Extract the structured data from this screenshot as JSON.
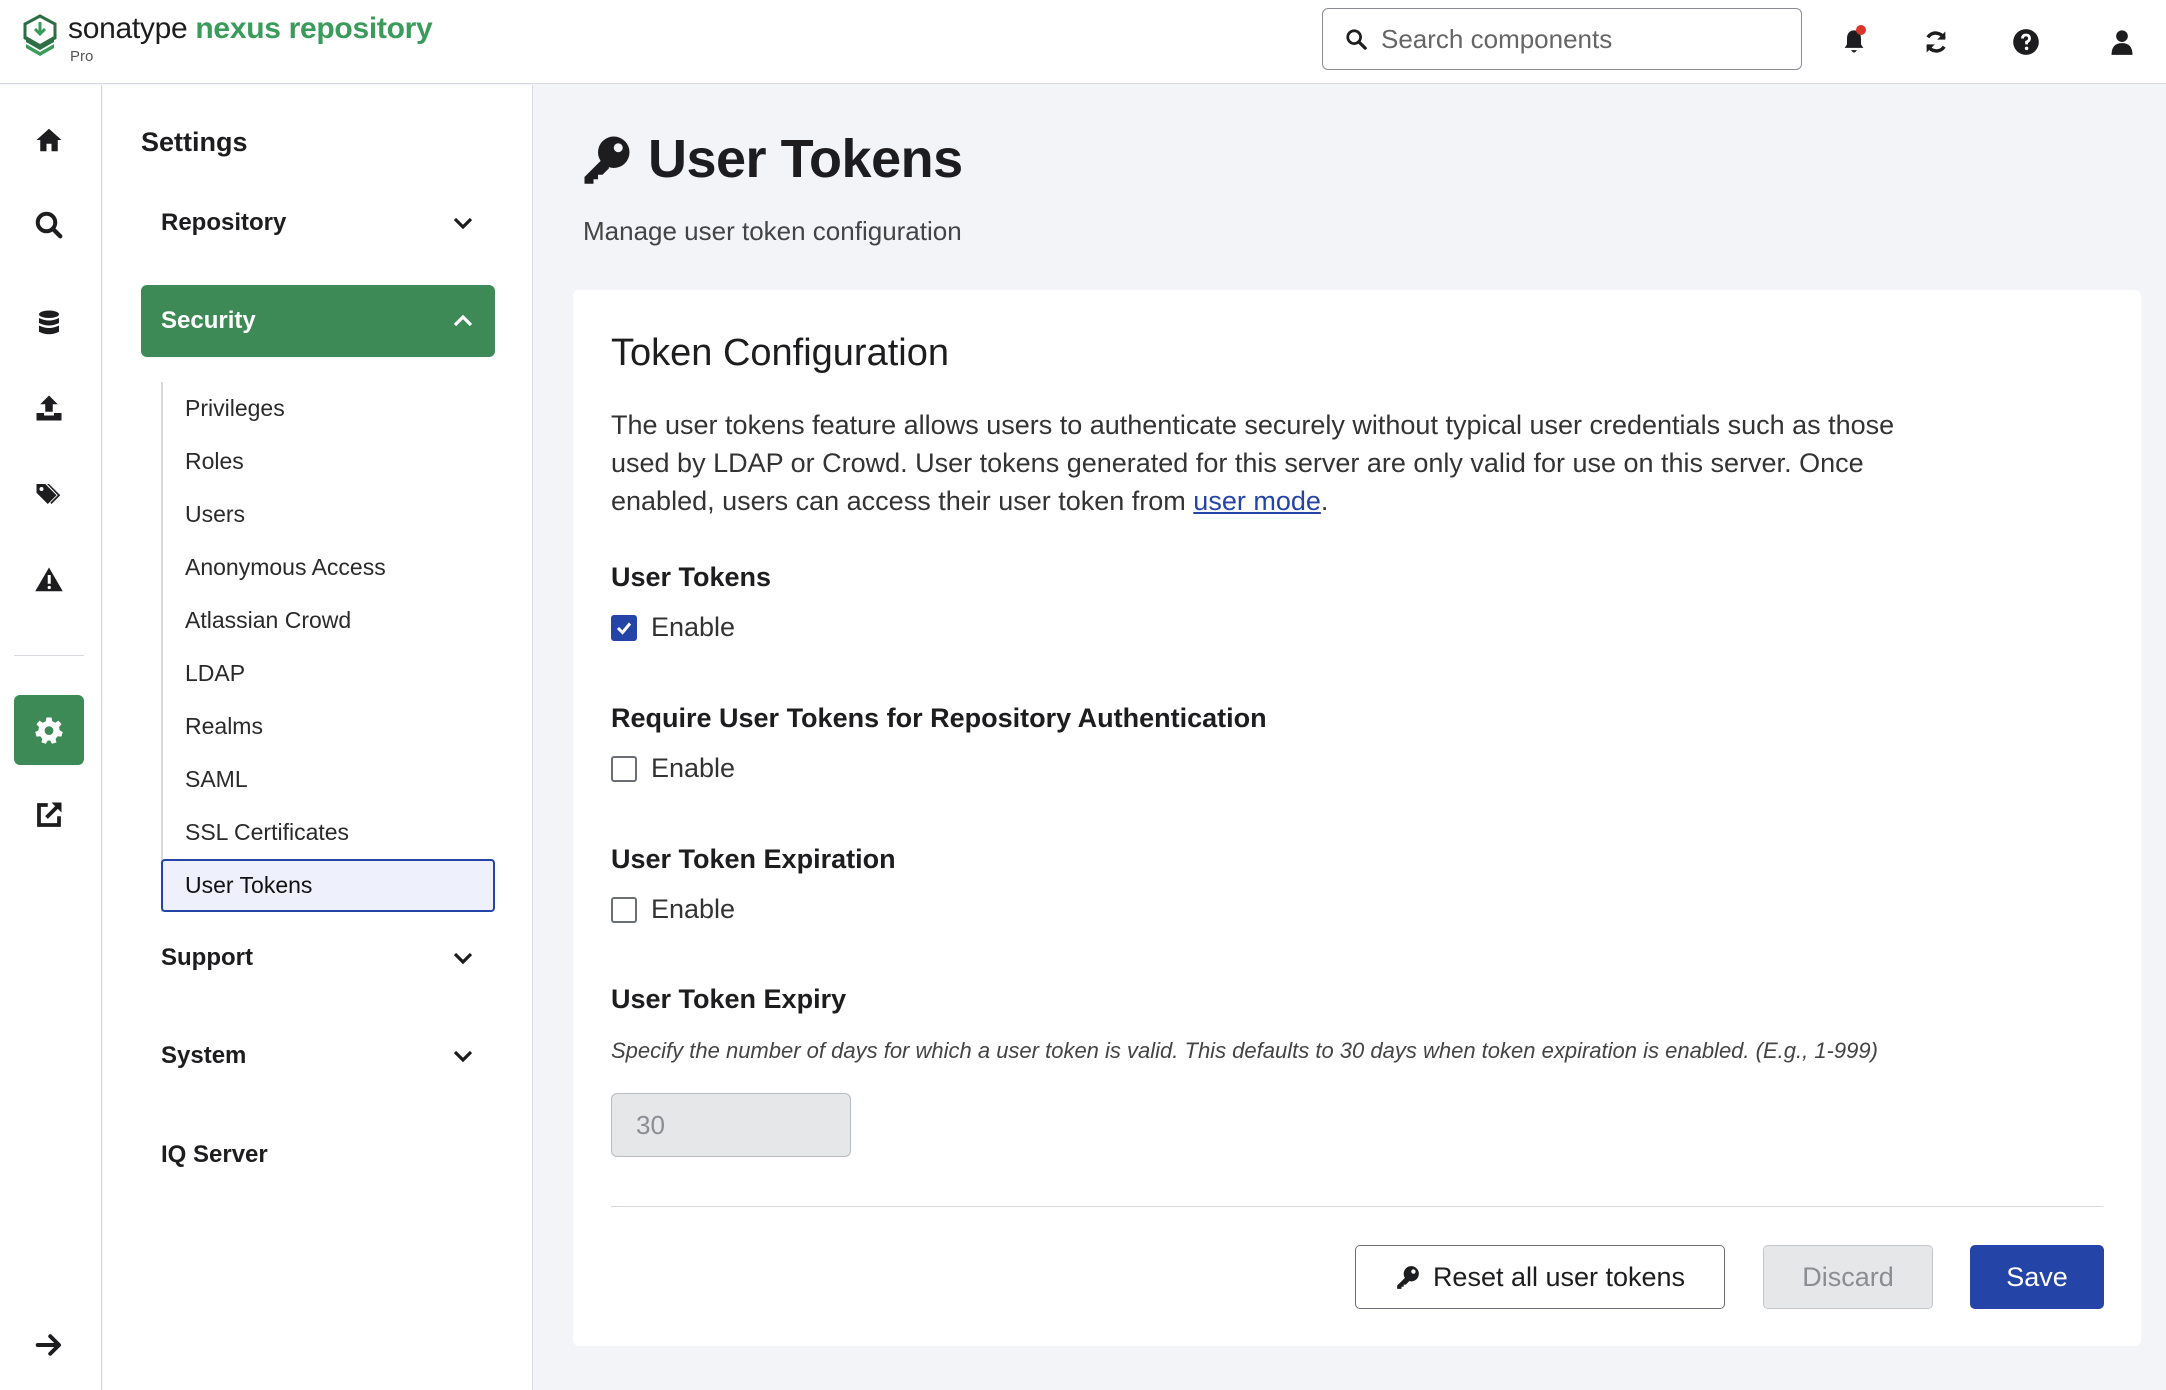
{
  "header": {
    "brand": "sonatype",
    "product": "nexus repository",
    "edition": "Pro",
    "search_placeholder": "Search components",
    "icons": [
      "bell-icon",
      "refresh-icon",
      "help-icon",
      "user-icon"
    ]
  },
  "rail": {
    "items": [
      "home-icon",
      "search-icon",
      "database-icon",
      "upload-icon",
      "tags-icon",
      "warning-icon",
      "gear-icon",
      "external-link-icon"
    ],
    "active": "gear-icon",
    "footer_icon": "arrow-right-icon"
  },
  "nav": {
    "title": "Settings",
    "groups": {
      "repository": "Repository",
      "security": "Security",
      "support": "Support",
      "system": "System",
      "iq_server": "IQ Server"
    },
    "security_items": [
      "Privileges",
      "Roles",
      "Users",
      "Anonymous Access",
      "Atlassian Crowd",
      "LDAP",
      "Realms",
      "SAML",
      "SSL Certificates",
      "User Tokens"
    ],
    "active_item": "User Tokens"
  },
  "page": {
    "title": "User Tokens",
    "subtitle": "Manage user token configuration"
  },
  "card": {
    "title": "Token Configuration",
    "desc_before_link": "The user tokens feature allows users to authenticate securely without typical user credentials such as those used by LDAP or Crowd. User tokens generated for this server are only valid for use on this server. Once enabled, users can access their user token from ",
    "desc_link": "user mode",
    "desc_after_link": ".",
    "user_tokens": {
      "label": "User Tokens",
      "checkbox": "Enable",
      "checked": true
    },
    "require_tokens": {
      "label": "Require User Tokens for Repository Authentication",
      "checkbox": "Enable",
      "checked": false
    },
    "expiration": {
      "label": "User Token Expiration",
      "checkbox": "Enable",
      "checked": false
    },
    "expiry": {
      "label": "User Token Expiry",
      "help": "Specify the number of days for which a user token is valid. This defaults to 30 days when token expiration is enabled. (E.g., 1-999)",
      "value": "30"
    },
    "buttons": {
      "reset": "Reset all user tokens",
      "discard": "Discard",
      "save": "Save"
    }
  },
  "colors": {
    "accent_green": "#3d8a57",
    "primary_blue": "#2544a8",
    "brand_green": "#3a9b5a"
  }
}
